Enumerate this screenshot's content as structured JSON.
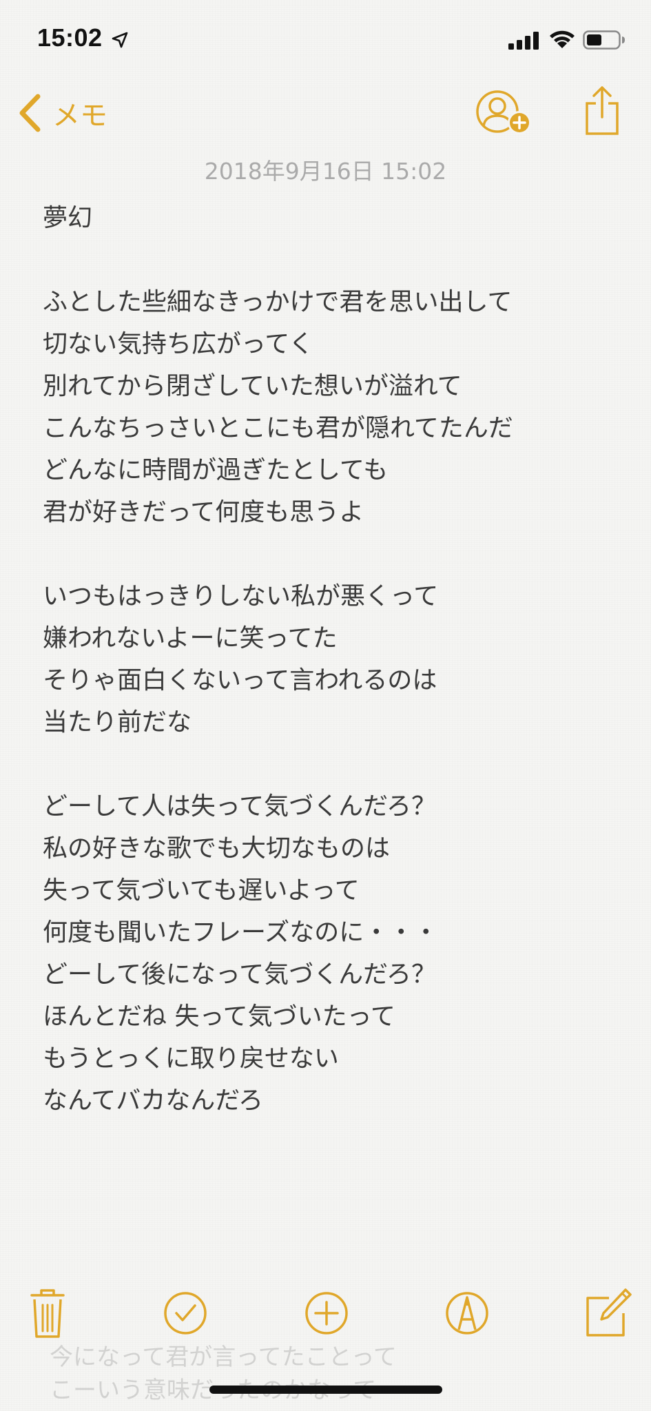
{
  "status_bar": {
    "time": "15:02",
    "icons": [
      "location-arrow-icon",
      "cellular-signal-icon",
      "wifi-icon",
      "battery-icon"
    ]
  },
  "nav": {
    "back_label": "メモ",
    "icons": [
      "chevron-left-icon",
      "add-person-icon",
      "share-icon"
    ]
  },
  "note": {
    "date": "2018年9月16日 15:02",
    "lines": [
      "夢幻",
      "",
      "ふとした些細なきっかけで君を思い出して",
      "切ない気持ち広がってく",
      "別れてから閉ざしていた想いが溢れて",
      "こんなちっさいとこにも君が隠れてたんだ",
      "どんなに時間が過ぎたとしても",
      "君が好きだって何度も思うよ",
      "",
      "いつもはっきりしない私が悪くって",
      "嫌われないよーに笑ってた",
      "そりゃ面白くないって言われるのは",
      "当たり前だな",
      "",
      "どーして人は失って気づくんだろ？",
      "私の好きな歌でも大切なものは",
      "失って気づいても遅いよって",
      "何度も聞いたフレーズなのに・・・",
      "どーして後になって気づくんだろ？",
      "ほんとだね 失って気づいたって",
      "もうとっくに取り戻せない",
      "なんてバカなんだろ"
    ],
    "ghost_lines": [
      "今になって君が言ってたことって",
      "こーいう意味だったのかなって"
    ]
  },
  "toolbar": {
    "icons": [
      "trash-icon",
      "checklist-icon",
      "add-icon",
      "markup-icon",
      "compose-icon"
    ]
  },
  "colors": {
    "accent": "#e0a72a",
    "text": "#3a3a3a",
    "date": "#aaaaaa",
    "background": "#f5f5f3"
  }
}
